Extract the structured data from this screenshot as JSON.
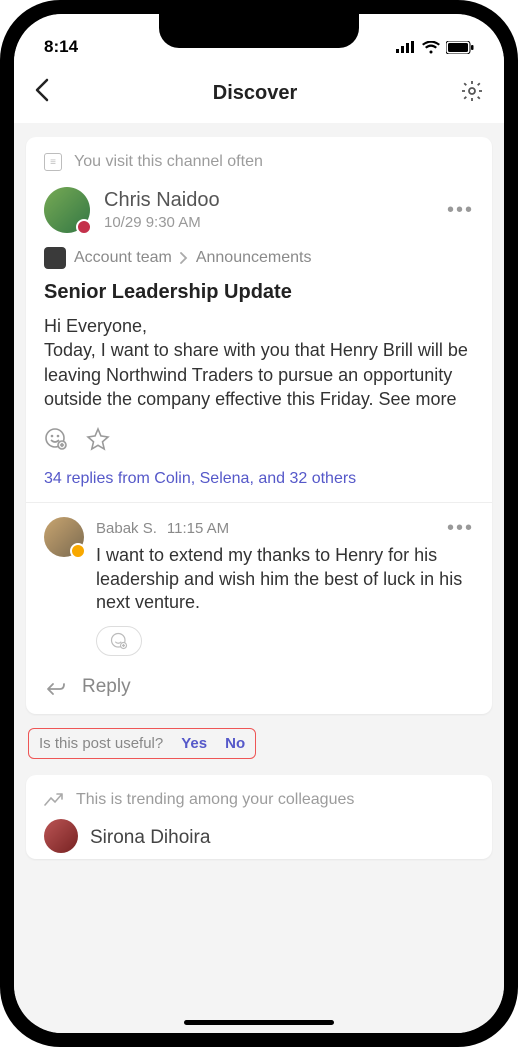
{
  "status": {
    "time": "8:14"
  },
  "header": {
    "title": "Discover"
  },
  "card1": {
    "hint": "You visit this channel often",
    "author": {
      "name": "Chris Naidoo",
      "timestamp": "10/29 9:30 AM"
    },
    "breadcrumb": {
      "team": "Account team",
      "channel": "Announcements"
    },
    "post": {
      "title": "Senior Leadership Update",
      "greeting": "Hi Everyone,",
      "body": "Today, I want to share with you that Henry Brill will be leaving Northwind Traders to pursue an opportunity outside the company effective this Friday. ",
      "see_more": "See more"
    },
    "replies_link": "34 replies from Colin, Selena, and 32 others",
    "reply1": {
      "author": "Babak S.",
      "time": "11:15 AM",
      "body": "I want to extend my thanks to Henry for his leadership and wish him the best of luck in his next venture."
    },
    "reply_label": "Reply"
  },
  "feedback": {
    "question": "Is this post useful?",
    "yes": "Yes",
    "no": "No"
  },
  "card2": {
    "hint": "This is trending among your colleagues",
    "author_partial": "Sirona Dihoira"
  }
}
